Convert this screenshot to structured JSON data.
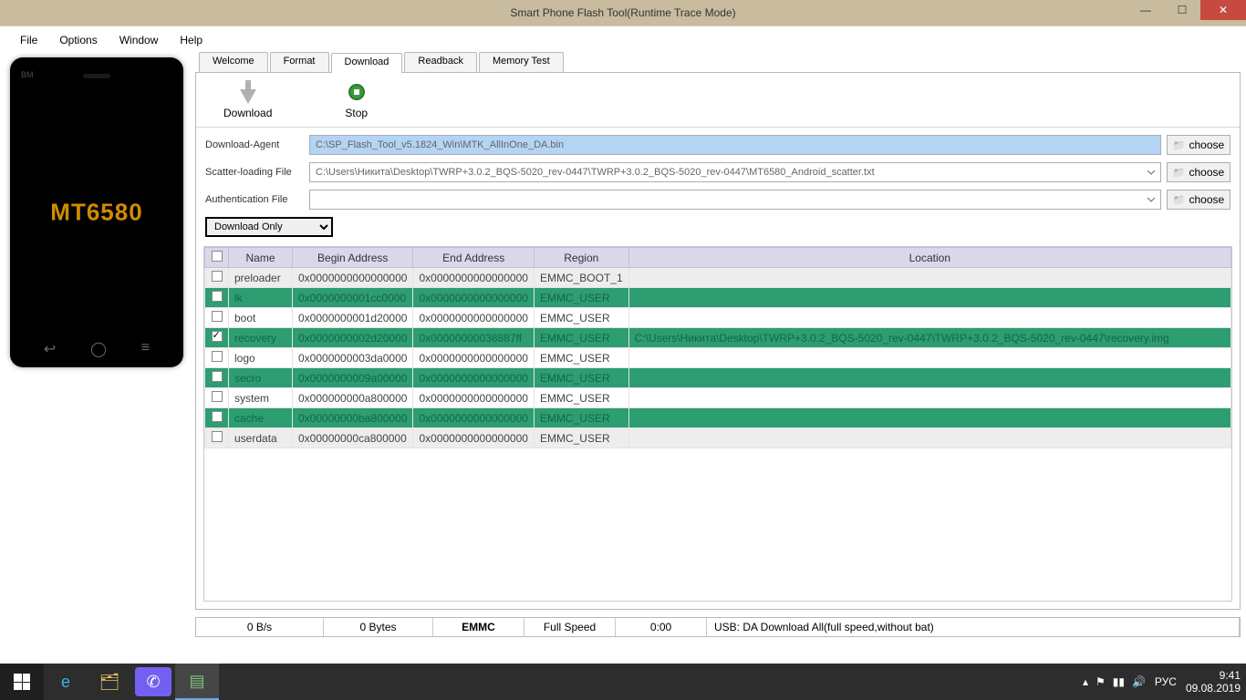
{
  "titlebar": {
    "title": "Smart Phone Flash Tool(Runtime Trace Mode)"
  },
  "menu": {
    "file": "File",
    "options": "Options",
    "window": "Window",
    "help": "Help"
  },
  "phone": {
    "brand": "BM",
    "chip": "MT6580"
  },
  "tabs": {
    "welcome": "Welcome",
    "format": "Format",
    "download": "Download",
    "readback": "Readback",
    "memtest": "Memory Test"
  },
  "toolbar": {
    "download": "Download",
    "stop": "Stop"
  },
  "form": {
    "da_label": "Download-Agent",
    "da_value": "C:\\SP_Flash_Tool_v5.1824_Win\\MTK_AllInOne_DA.bin",
    "scatter_label": "Scatter-loading File",
    "scatter_value": "C:\\Users\\Никита\\Desktop\\TWRP+3.0.2_BQS-5020_rev-0447\\TWRP+3.0.2_BQS-5020_rev-0447\\MT6580_Android_scatter.txt",
    "auth_label": "Authentication File",
    "auth_value": "",
    "choose": "choose",
    "mode": "Download Only"
  },
  "table": {
    "headers": {
      "name": "Name",
      "begin": "Begin Address",
      "end": "End Address",
      "region": "Region",
      "location": "Location"
    },
    "rows": [
      {
        "chk": false,
        "cls": "gray",
        "name": "preloader",
        "begin": "0x0000000000000000",
        "end": "0x0000000000000000",
        "region": "EMMC_BOOT_1",
        "loc": ""
      },
      {
        "chk": false,
        "cls": "green",
        "name": "lk",
        "begin": "0x0000000001cc0000",
        "end": "0x0000000000000000",
        "region": "EMMC_USER",
        "loc": ""
      },
      {
        "chk": false,
        "cls": "",
        "name": "boot",
        "begin": "0x0000000001d20000",
        "end": "0x0000000000000000",
        "region": "EMMC_USER",
        "loc": ""
      },
      {
        "chk": true,
        "cls": "green",
        "name": "recovery",
        "begin": "0x0000000002d20000",
        "end": "0x00000000038887ff",
        "region": "EMMC_USER",
        "loc": "C:\\Users\\Никита\\Desktop\\TWRP+3.0.2_BQS-5020_rev-0447\\TWRP+3.0.2_BQS-5020_rev-0447\\recovery.img"
      },
      {
        "chk": false,
        "cls": "",
        "name": "logo",
        "begin": "0x0000000003da0000",
        "end": "0x0000000000000000",
        "region": "EMMC_USER",
        "loc": ""
      },
      {
        "chk": false,
        "cls": "green",
        "name": "secro",
        "begin": "0x0000000009a00000",
        "end": "0x0000000000000000",
        "region": "EMMC_USER",
        "loc": ""
      },
      {
        "chk": false,
        "cls": "",
        "name": "system",
        "begin": "0x000000000a800000",
        "end": "0x0000000000000000",
        "region": "EMMC_USER",
        "loc": ""
      },
      {
        "chk": false,
        "cls": "green",
        "name": "cache",
        "begin": "0x00000000ba800000",
        "end": "0x0000000000000000",
        "region": "EMMC_USER",
        "loc": ""
      },
      {
        "chk": false,
        "cls": "gray",
        "name": "userdata",
        "begin": "0x00000000ca800000",
        "end": "0x0000000000000000",
        "region": "EMMC_USER",
        "loc": ""
      }
    ]
  },
  "status": {
    "speed": "0 B/s",
    "bytes": "0 Bytes",
    "storage": "EMMC",
    "mode": "Full Speed",
    "time": "0:00",
    "usb": "USB: DA Download All(full speed,without bat)"
  },
  "tray": {
    "lang": "РУС",
    "time": "9:41",
    "date": "09.08.2019"
  }
}
